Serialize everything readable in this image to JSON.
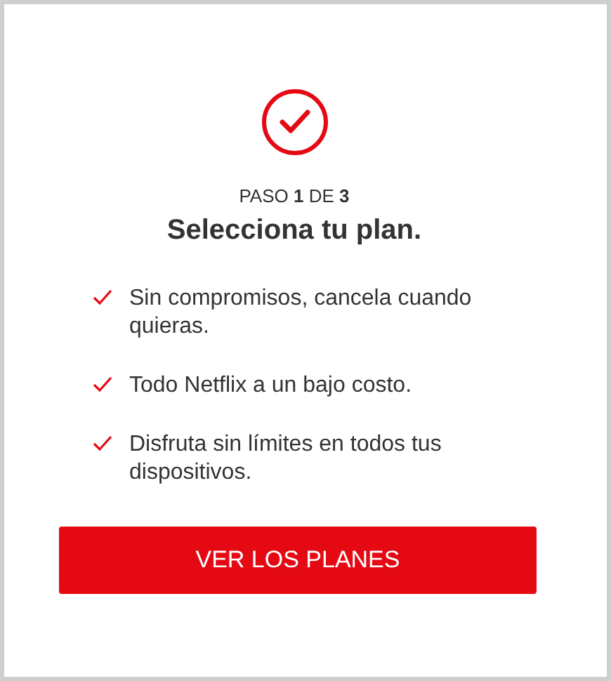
{
  "step": "PASO **1** DE **3**",
  "title": "Selecciona tu plan.",
  "benefits": [
    "Sin compromisos, cancela cuando quieras.",
    "Todo Netflix a un bajo costo.",
    "Disfruta sin límites en todos tus dispositivos."
  ],
  "button": "VER LOS PLANES"
}
